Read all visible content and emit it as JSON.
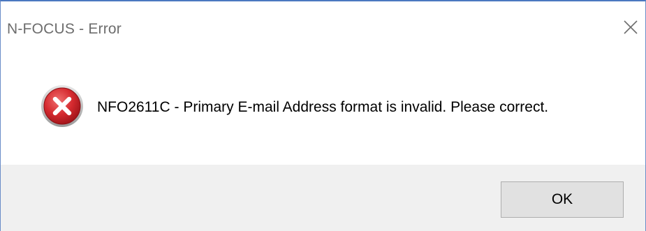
{
  "window": {
    "title": "N-FOCUS - Error"
  },
  "icons": {
    "close": "close-icon",
    "status": "error-icon"
  },
  "message": {
    "text": "NFO2611C - Primary E-mail Address format is invalid. Please correct."
  },
  "buttons": {
    "ok_label": "OK"
  },
  "colors": {
    "error_red": "#c8232c",
    "footer_bg": "#f0f0f0",
    "button_bg": "#e1e1e1",
    "button_border": "#adadad",
    "title_text": "#6d6d6d"
  }
}
